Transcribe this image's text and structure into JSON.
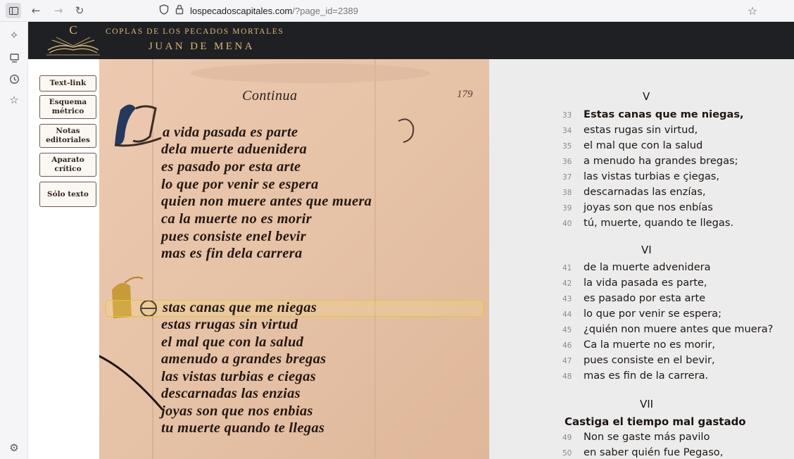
{
  "browser": {
    "url_host": "lospecadoscapitales.com",
    "url_path": "/?page_id=2389",
    "icons": {
      "sidebar_toggle": "sidebar-toggle-icon",
      "back": "back-arrow-icon",
      "forward": "forward-arrow-icon",
      "reload": "reload-icon",
      "shield": "shield-icon",
      "lock": "lock-icon",
      "bookmark": "star-icon"
    },
    "sidebar_icons": [
      "sparkle-icon",
      "sync-icon",
      "history-icon",
      "bookmarks-star-icon",
      "settings-gear-icon"
    ]
  },
  "site": {
    "logo_letter": "C",
    "supertitle": "COPLAS DE LOS PECADOS MORTALES",
    "author": "JUAN DE MENA",
    "accent_color": "#d9b77a",
    "header_bg": "#1f2023"
  },
  "controls": [
    {
      "label": "Text-link"
    },
    {
      "label": "Esquema métrico"
    },
    {
      "label": "Notas editoriales"
    },
    {
      "label": "Aparato crítico"
    },
    {
      "label": "Sólo texto"
    }
  ],
  "manuscript": {
    "page_number": "179",
    "heading": "Continua",
    "lines_block1": [
      "a vida pasada es parte",
      "dela muerte aduenidera",
      "es pasado por esta arte",
      "lo que por venir se espera",
      "quien non muere antes que muera",
      "ca la muerte no es morir",
      "pues consiste enel bevir",
      "mas es fin dela carrera"
    ],
    "lines_block2": [
      "stas canas que me niegas",
      "estas rrugas sin virtud",
      "el mal que con la salud",
      "amenudo a grandes bregas",
      "las vistas turbias e ciegas",
      "descarnadas las enzias",
      "joyas son que nos enbias",
      "tu muerte quando te llegas"
    ]
  },
  "edition": {
    "stanzas": [
      {
        "title": "V",
        "verses": [
          {
            "n": "33",
            "text": "Estas canas que me niegas,"
          },
          {
            "n": "34",
            "text": "estas rugas sin virtud,"
          },
          {
            "n": "35",
            "text": "el mal que con la salud"
          },
          {
            "n": "36",
            "text": "a menudo ha grandes bregas;"
          },
          {
            "n": "37",
            "text": "las vistas turbias e çiegas,"
          },
          {
            "n": "38",
            "text": "descarnadas las enzías,"
          },
          {
            "n": "39",
            "text": "joyas son que nos enbías"
          },
          {
            "n": "40",
            "text": "tú, muerte, quando te llegas."
          }
        ]
      },
      {
        "title": "VI",
        "verses": [
          {
            "n": "41",
            "text": "de la muerte advenidera"
          },
          {
            "n": "42",
            "text": "la vida pasada es parte,"
          },
          {
            "n": "43",
            "text": "es pasado por esta arte"
          },
          {
            "n": "44",
            "text": "lo que por venir se espera;"
          },
          {
            "n": "45",
            "text": "¿quién non muere antes que muera?"
          },
          {
            "n": "46",
            "text": "Ca la muerte no es morir,"
          },
          {
            "n": "47",
            "text": "pues consiste en el bevir,"
          },
          {
            "n": "48",
            "text": "mas es fin de la carrera."
          }
        ]
      },
      {
        "title": "VII",
        "caption": "Castiga el tiempo mal gastado",
        "verses": [
          {
            "n": "49",
            "text": "Non se gaste más pavilo"
          },
          {
            "n": "50",
            "text": "en saber quién fue Pegaso,"
          }
        ]
      }
    ]
  }
}
